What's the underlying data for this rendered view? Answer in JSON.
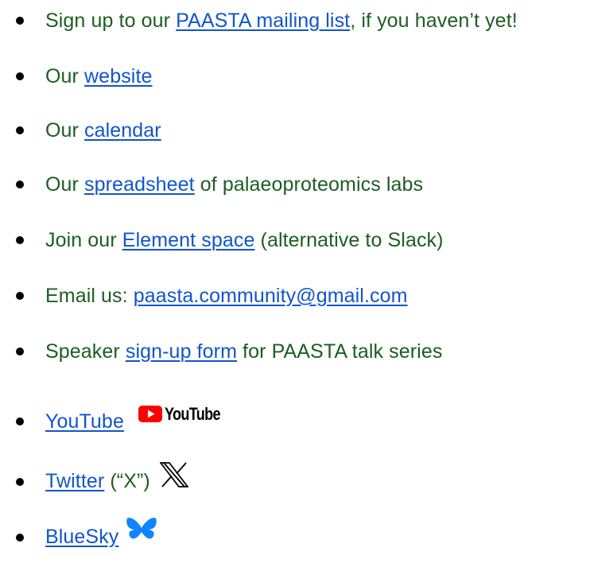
{
  "items": [
    {
      "prefix": "Sign up to our ",
      "link": "PAASTA mailing list",
      "suffix": ", if you haven’t yet!"
    },
    {
      "prefix": "Our ",
      "link": "website",
      "suffix": ""
    },
    {
      "prefix": "Our ",
      "link": "calendar",
      "suffix": ""
    },
    {
      "prefix": "Our ",
      "link": "spreadsheet",
      "suffix": " of palaeoproteomics labs"
    },
    {
      "prefix": "Join our ",
      "link": "Element space",
      "suffix": " (alternative to Slack)"
    },
    {
      "prefix": "Email us: ",
      "link": "paasta.community@gmail.com",
      "suffix": ""
    },
    {
      "prefix": "Speaker ",
      "link": "sign-up form",
      "suffix": " for PAASTA talk series"
    },
    {
      "prefix": "",
      "link": "YouTube",
      "suffix": "",
      "logo_text": "YouTube",
      "icon": "youtube-logo-icon"
    },
    {
      "prefix": "",
      "link": "Twitter",
      "suffix": " (“X”)",
      "icon": "x-logo-icon"
    },
    {
      "prefix": "",
      "link": "BlueSky",
      "suffix": "",
      "icon": "bluesky-butterfly-icon"
    }
  ],
  "colors": {
    "text": "#1b5e20",
    "link": "#1155cc",
    "bullet": "#000000",
    "youtube_red": "#ff0000",
    "bluesky_blue": "#1185fe"
  }
}
